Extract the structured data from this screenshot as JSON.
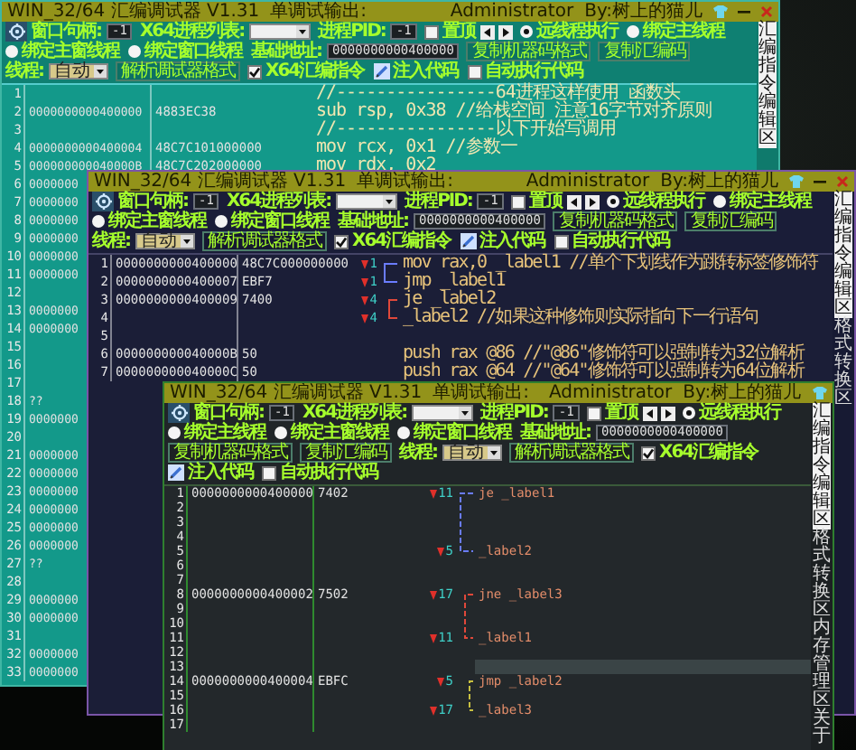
{
  "windows": [
    {
      "title": "WIN_32/64 汇编调试器 V1.31",
      "output_label": "单调试输出:",
      "user": "Administrator",
      "author": "By:树上的猫儿",
      "toolbar": {
        "handle_label": "窗口句柄:",
        "handle_value": "-1",
        "process_list_label": "X64进程列表:",
        "pid_label": "进程PID:",
        "pid_value": "-1",
        "topmost": {
          "label": "置顶",
          "checked": false
        },
        "modes": [
          {
            "label": "远线程执行",
            "selected": true
          },
          {
            "label": "绑定主线程",
            "selected": false
          },
          {
            "label": "绑定主窗线程",
            "selected": false
          },
          {
            "label": "绑定窗口线程",
            "selected": false
          }
        ],
        "base_label": "基础地址:",
        "base_value": "0000000000400000",
        "copy_buttons": [
          "复制机器码格式",
          "复制汇编码"
        ],
        "thread_label": "线程:",
        "thread_value": "自动",
        "parse_button": "解析调试器格式",
        "x64": {
          "label": "X64汇编指令",
          "checked": true
        },
        "inject_button": "注入代码",
        "auto_exec": {
          "label": "自动执行代码",
          "checked": false
        }
      },
      "rows": [
        {
          "line": "1",
          "code": "//----------------64进程这样使用 函数头"
        },
        {
          "line": "2",
          "address": "0000000000400000",
          "machine": "4883EC38",
          "code": "sub rsp, 0x38 //给栈空间 注意16字节对齐原则"
        },
        {
          "line": "3",
          "code": "//----------------以下开始写调用"
        },
        {
          "line": "4",
          "address": "0000000000400004",
          "machine": "48C7C101000000",
          "code": "mov rcx, 0x1 //参数一"
        },
        {
          "line": "5",
          "address": "000000000040000B",
          "machine": "48C7C202000000",
          "code": "mov rdx, 0x2"
        },
        {
          "line": "6",
          "address": "0000000"
        },
        {
          "line": "7",
          "address": "0000000"
        },
        {
          "line": "8",
          "address": "0000000"
        },
        {
          "line": "9",
          "address": "0000000"
        },
        {
          "line": "10",
          "address": "0000000"
        },
        {
          "line": "11",
          "address": "0000000"
        },
        {
          "line": "12"
        },
        {
          "line": "13",
          "address": "0000000"
        },
        {
          "line": "14",
          "address": "0000000"
        },
        {
          "line": "15"
        },
        {
          "line": "16"
        },
        {
          "line": "17"
        },
        {
          "line": "18",
          "address": "??"
        },
        {
          "line": "19",
          "address": "0000000"
        },
        {
          "line": "20"
        },
        {
          "line": "21",
          "address": "0000000"
        },
        {
          "line": "22",
          "address": "0000000"
        },
        {
          "line": "23",
          "address": "0000000"
        },
        {
          "line": "24",
          "address": "0000000"
        },
        {
          "line": "25",
          "address": "0000000"
        },
        {
          "line": "26",
          "address": "0000000"
        },
        {
          "line": "27",
          "address": "??"
        },
        {
          "line": "28"
        },
        {
          "line": "29",
          "address": "0000000"
        },
        {
          "line": "30",
          "address": "0000000"
        },
        {
          "line": "31"
        },
        {
          "line": "32",
          "address": "0000000"
        },
        {
          "line": "33",
          "address": "0000000"
        }
      ],
      "side_tabs": [
        {
          "label": "汇编指令编辑区",
          "selected": true
        }
      ]
    },
    {
      "title": "WIN_32/64 汇编调试器 V1.31",
      "output_label": "单调试输出:",
      "user": "Administrator",
      "author": "By:树上的猫儿",
      "toolbar": {
        "handle_label": "窗口句柄:",
        "handle_value": "-1",
        "process_list_label": "X64进程列表:",
        "pid_label": "进程PID:",
        "pid_value": "-1",
        "topmost": {
          "label": "置顶",
          "checked": false
        },
        "modes": [
          {
            "label": "远线程执行",
            "selected": true
          },
          {
            "label": "绑定主线程",
            "selected": false
          },
          {
            "label": "绑定主窗线程",
            "selected": false
          },
          {
            "label": "绑定窗口线程",
            "selected": false
          }
        ],
        "base_label": "基础地址:",
        "base_value": "0000000000400000",
        "copy_buttons": [
          "复制机器码格式",
          "复制汇编码"
        ],
        "thread_label": "线程:",
        "thread_value": "自动",
        "parse_button": "解析调试器格式",
        "x64": {
          "label": "X64汇编指令",
          "checked": true
        },
        "inject_button": "注入代码",
        "auto_exec": {
          "label": "自动执行代码",
          "checked": false
        }
      },
      "rows": [
        {
          "line": "1",
          "address": "0000000000400000",
          "machine": "48C7C000000000",
          "jump": "1",
          "code": "mov rax,0 _label1 //单个下划线作为跳转标签修饰符"
        },
        {
          "line": "2",
          "address": "0000000000400007",
          "machine": "EBF7",
          "jump": "1",
          "code": "jmp _label1"
        },
        {
          "line": "3",
          "address": "0000000000400009",
          "machine": "7400",
          "jump": "4",
          "code": "je _label2"
        },
        {
          "line": "4",
          "jump": "4",
          "code": "_label2 //如果这种修饰则实际指向下一行语句"
        },
        {
          "line": "5"
        },
        {
          "line": "6",
          "address": "000000000040000B",
          "machine": "50",
          "code": "push rax @86 //\"@86\"修饰符可以强制转为32位解析"
        },
        {
          "line": "7",
          "address": "000000000040000C",
          "machine": "50",
          "code": "push rax @64 //\"@64\"修饰符可以强制转为64位解析"
        }
      ],
      "side_tabs": [
        {
          "label": "汇编指令编辑区",
          "selected": true
        },
        {
          "label": "格式转换区",
          "selected": false
        }
      ]
    },
    {
      "title": "WIN_32/64 汇编调试器 V1.31",
      "output_label": "单调试输出:",
      "user": "Administrator",
      "author": "By:树上的猫儿",
      "toolbar": {
        "handle_label": "窗口句柄:",
        "handle_value": "-1",
        "process_list_label": "X64进程列表:",
        "pid_label": "进程PID:",
        "pid_value": "-1",
        "topmost": {
          "label": "置顶",
          "checked": false
        },
        "modes": [
          {
            "label": "远线程执行",
            "selected": true
          },
          {
            "label": "绑定主线程",
            "selected": false
          },
          {
            "label": "绑定主窗线程",
            "selected": false
          },
          {
            "label": "绑定窗口线程",
            "selected": false
          }
        ],
        "base_label": "基础地址:",
        "base_value": "0000000000400000",
        "copy_buttons": [
          "复制机器码格式",
          "复制汇编码"
        ],
        "thread_label": "线程:",
        "thread_value": "自动",
        "parse_button": "解析调试器格式",
        "x64": {
          "label": "X64汇编指令",
          "checked": true
        },
        "inject_button": "注入代码",
        "auto_exec": {
          "label": "自动执行代码",
          "checked": false
        }
      },
      "rows": [
        {
          "line": "1",
          "address": "0000000000400000",
          "machine": "7402",
          "jump": "11",
          "code": "je _label1",
          "highlighted": false
        },
        {
          "line": "2",
          "highlighted": false
        },
        {
          "line": "3",
          "highlighted": false
        },
        {
          "line": "4",
          "highlighted": false
        },
        {
          "line": "5",
          "jump": "5",
          "code": "_label2",
          "highlighted": false
        },
        {
          "line": "6",
          "highlighted": false
        },
        {
          "line": "7",
          "highlighted": false
        },
        {
          "line": "8",
          "address": "0000000000400002",
          "machine": "7502",
          "jump": "17",
          "code": "jne _label3",
          "highlighted": false
        },
        {
          "line": "9",
          "highlighted": false
        },
        {
          "line": "10",
          "highlighted": false
        },
        {
          "line": "11",
          "jump": "11",
          "code": "_label1",
          "highlighted": false
        },
        {
          "line": "12",
          "highlighted": false
        },
        {
          "line": "13",
          "highlighted": true
        },
        {
          "line": "14",
          "address": "0000000000400004",
          "machine": "EBFC",
          "jump": "5",
          "code": "jmp _label2",
          "highlighted": false
        },
        {
          "line": "15",
          "highlighted": false
        },
        {
          "line": "16",
          "jump": "17",
          "code": "_label3",
          "highlighted": false
        },
        {
          "line": "17",
          "highlighted": false
        }
      ],
      "side_tabs": [
        {
          "label": "汇编指令编辑区",
          "selected": true
        },
        {
          "label": "格式转换区",
          "selected": false
        },
        {
          "label": "内存管理区",
          "selected": false
        },
        {
          "label": "关于",
          "selected": false
        }
      ]
    }
  ]
}
